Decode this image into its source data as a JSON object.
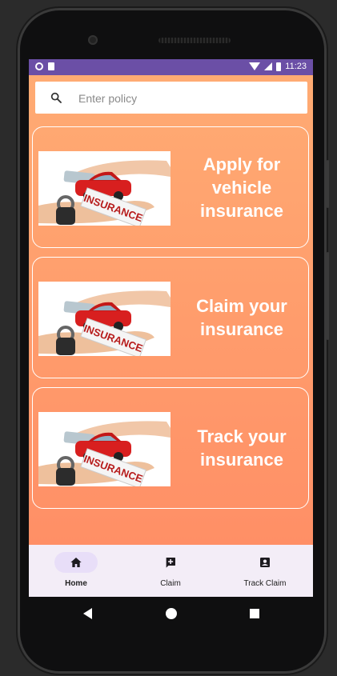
{
  "status_bar": {
    "time": "11:23"
  },
  "search": {
    "placeholder": "Enter policy",
    "icon": "search-icon"
  },
  "cards": [
    {
      "title": "Apply for vehicle insurance",
      "image": "insurance-car-image"
    },
    {
      "title": "Claim your insurance",
      "image": "insurance-car-image"
    },
    {
      "title": "Track your insurance",
      "image": "insurance-car-image"
    }
  ],
  "image_text": "INSURANCE",
  "bottom_nav": {
    "items": [
      {
        "label": "Home",
        "icon": "home-icon",
        "active": true
      },
      {
        "label": "Claim",
        "icon": "add-box-icon",
        "active": false
      },
      {
        "label": "Track Claim",
        "icon": "account-box-icon",
        "active": false
      }
    ]
  },
  "colors": {
    "status_bar": "#6b4fa6",
    "gradient_top": "#ffab73",
    "gradient_bottom": "#ff8f66",
    "nav_background": "#f3edf7",
    "nav_active_pill": "#e8def8"
  }
}
